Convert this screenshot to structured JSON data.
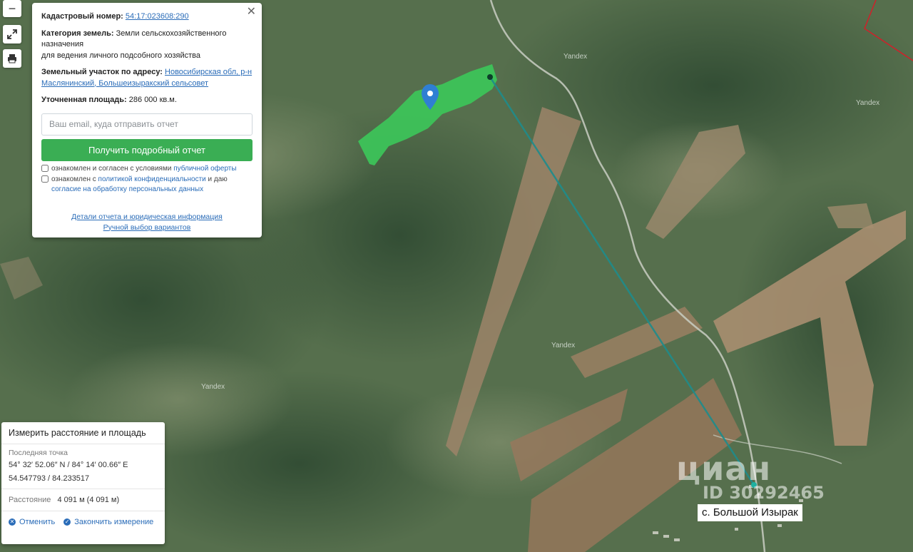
{
  "map": {
    "watermarks": [
      "Yandex",
      "Yandex",
      "Yandex",
      "Yandex"
    ],
    "place_label": "с. Большой Изырак",
    "cian_logo": "циан",
    "cian_id": "ID 30292465",
    "plot_color": "#3cc85a",
    "route_color": "#1e8c8c"
  },
  "controls": {
    "zoom_out": "−",
    "fullscreen_icon": "expand-icon",
    "print_icon": "printer-icon"
  },
  "card": {
    "cadastral_label": "Кадастровый номер:",
    "cadastral_value": "54:17:023608:290",
    "category_label": "Категория земель:",
    "category_value": "Земли сельскохозяйственного назначения",
    "category_use": "для ведения личного подсобного хозяйства",
    "address_label": "Земельный участок по адресу:",
    "address_value": "Новосибирская обл, р-н Маслянинский, Большеизыракский сельсовет",
    "area_label": "Уточненная площадь:",
    "area_value": "286 000 кв.м.",
    "email_placeholder": "Ваш email, куда отправить отчет",
    "submit_label": "Получить подробный отчет",
    "agree1_text": "ознакомлен и согласен с условиями",
    "agree1_link": "публичной оферты",
    "agree2_text": "ознакомлен с",
    "agree2_link": "политикой конфиденциальности",
    "agree2_mid": "и даю",
    "agree2_link2": "согласие на обработку персональных данных",
    "link_details": "Детали отчета и юридическая информация",
    "link_manual": "Ручной выбор вариантов",
    "close": "✕"
  },
  "measure": {
    "title": "Измерить расстояние и площадь",
    "last_point_label": "Последняя точка",
    "coords_dms": "54° 32′ 52.06″ N / 84° 14′ 00.66″ E",
    "coords_dec": "54.547793 / 84.233517",
    "distance_label": "Расстояние",
    "distance_value": "4 091 м (4 091 м)",
    "cancel_label": "Отменить",
    "finish_label": "Закончить измерение"
  }
}
